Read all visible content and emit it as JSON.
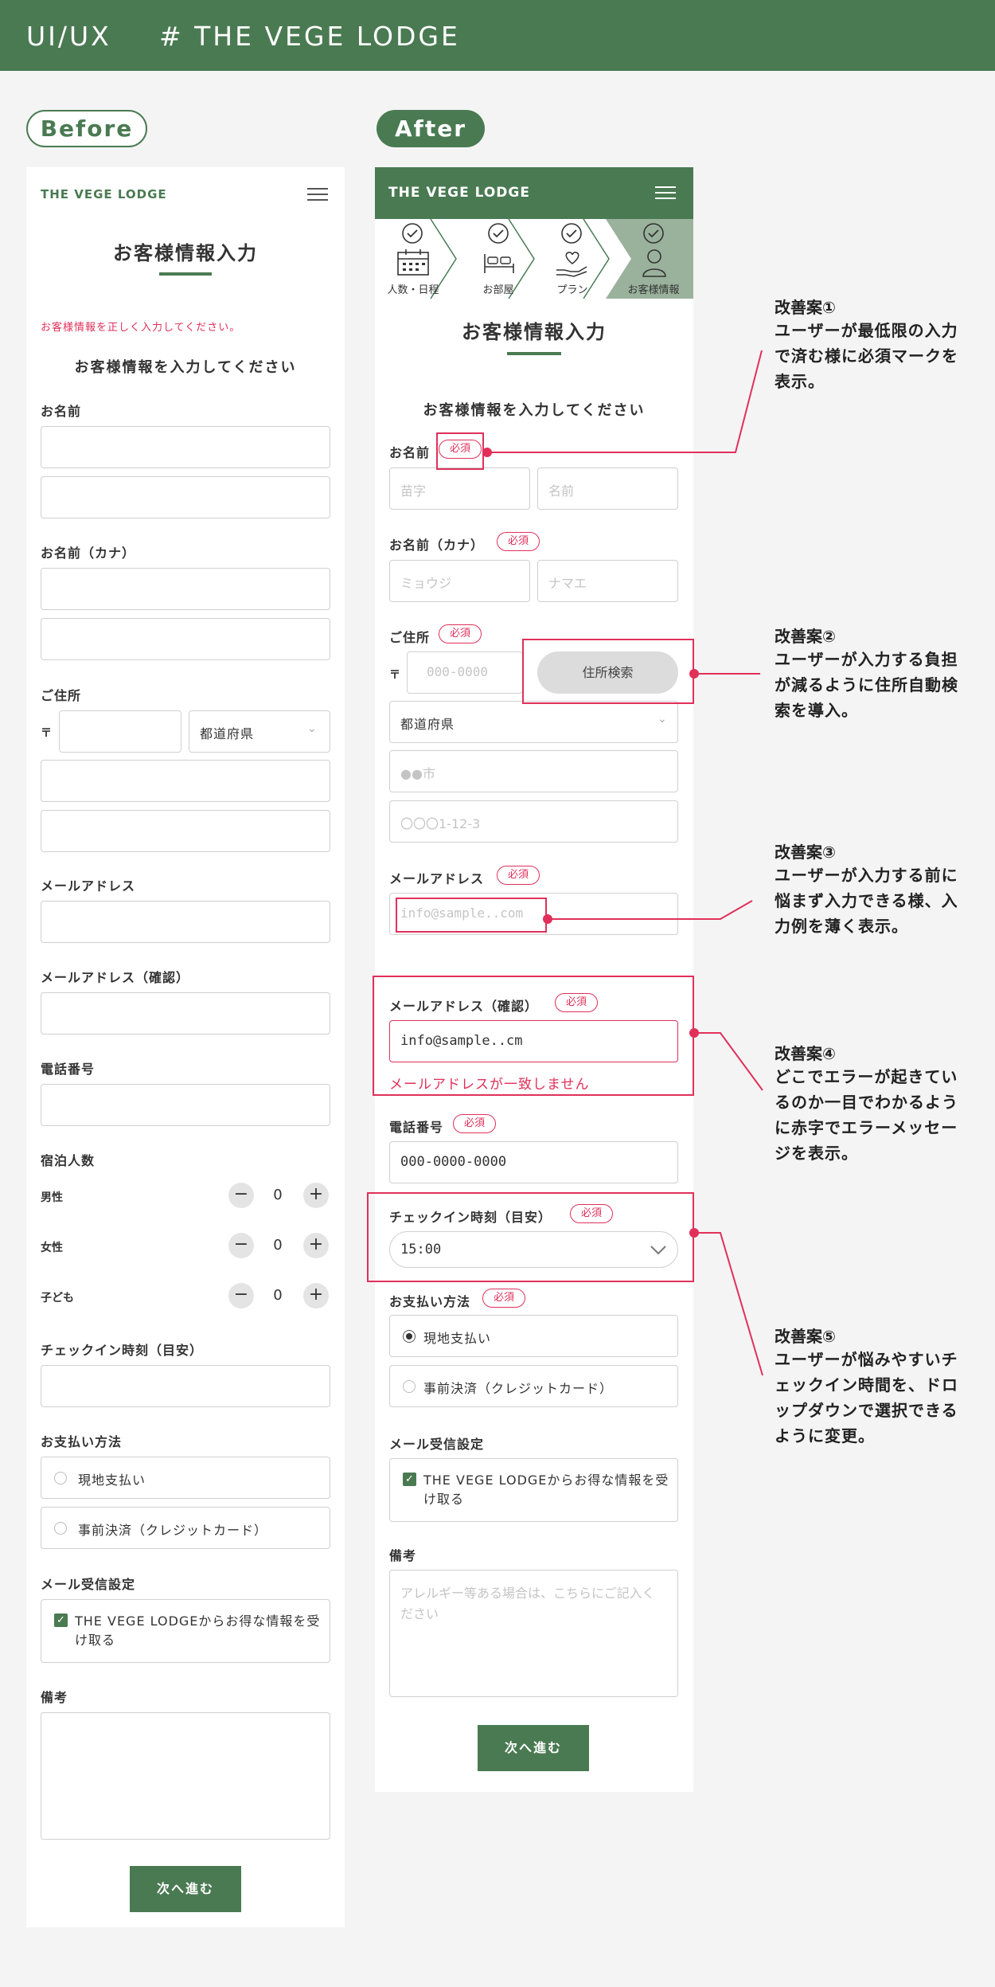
{
  "header": {
    "category": "UI/UX",
    "project": "# THE VEGE LODGE"
  },
  "tags": {
    "before": "Before",
    "after": "After"
  },
  "colors": {
    "brand_green": "#4a7a52",
    "error_red": "#e0305a",
    "background": "#f4f4f4"
  },
  "before": {
    "brand": "THE VEGE LODGE",
    "title": "お客様情報入力",
    "error": "お客様情報を正しく入力してください。",
    "subtitle": "お客様情報を入力してください",
    "name_label": "お名前",
    "kana_label": "お名前（カナ）",
    "address_label": "ご住所",
    "postal_mark": "〒",
    "prefecture": "都道府県",
    "email_label": "メールアドレス",
    "email_confirm_label": "メールアドレス（確認）",
    "phone_label": "電話番号",
    "guests_label": "宿泊人数",
    "guests": [
      {
        "label": "男性",
        "count": "0"
      },
      {
        "label": "女性",
        "count": "0"
      },
      {
        "label": "子ども",
        "count": "0"
      }
    ],
    "checkin_label": "チェックイン時刻（目安）",
    "payment_label": "お支払い方法",
    "payment_options": [
      "現地支払い",
      "事前決済（クレジットカード）"
    ],
    "mail_label": "メール受信設定",
    "mail_option": "THE VEGE LODGEからお得な情報を受け取る",
    "notes_label": "備考",
    "next": "次へ進む"
  },
  "after": {
    "brand": "THE VEGE LODGE",
    "steps": [
      "人数・日程",
      "お部屋",
      "プラン",
      "お客様情報"
    ],
    "title": "お客様情報入力",
    "subtitle": "お客様情報を入力してください",
    "required": "必須",
    "name_label": "お名前",
    "name_placeholders": [
      "苗字",
      "名前"
    ],
    "kana_label": "お名前（カナ）",
    "kana_placeholders": [
      "ミョウジ",
      "ナマエ"
    ],
    "address_label": "ご住所",
    "postal_mark": "〒",
    "postal_placeholder": "000-0000",
    "address_search": "住所検索",
    "prefecture": "都道府県",
    "city_placeholder": "●●市",
    "street_placeholder": "〇〇〇1-12-3",
    "email_label": "メールアドレス",
    "email_placeholder": "info@sample..com",
    "email_confirm_label": "メールアドレス（確認）",
    "email_confirm_value": "info@sample..cm",
    "email_error": "メールアドレスが一致しません",
    "phone_label": "電話番号",
    "phone_value": "000-0000-0000",
    "checkin_label": "チェックイン時刻（目安）",
    "checkin_value": "15:00",
    "payment_label": "お支払い方法",
    "payment_options": [
      "現地支払い",
      "事前決済（クレジットカード）"
    ],
    "mail_label": "メール受信設定",
    "mail_option": "THE VEGE LODGEからお得な情報を受け取る",
    "notes_label": "備考",
    "notes_placeholder": "アレルギー等ある場合は、こちらにご記入ください",
    "next": "次へ進む"
  },
  "notes": [
    {
      "title": "改善案①",
      "text": "ユーザーが最低限の入力で済む様に必須マークを表示。"
    },
    {
      "title": "改善案②",
      "text": "ユーザーが入力する負担が減るように住所自動検索を導入。"
    },
    {
      "title": "改善案③",
      "text": "ユーザーが入力する前に悩まず入力できる様、入力例を薄く表示。"
    },
    {
      "title": "改善案④",
      "text": "どこでエラーが起きているのか一目でわかるように赤字でエラーメッセージを表示。"
    },
    {
      "title": "改善案⑤",
      "text": "ユーザーが悩みやすいチェックイン時間を、ドロップダウンで選択できるように変更。"
    }
  ]
}
